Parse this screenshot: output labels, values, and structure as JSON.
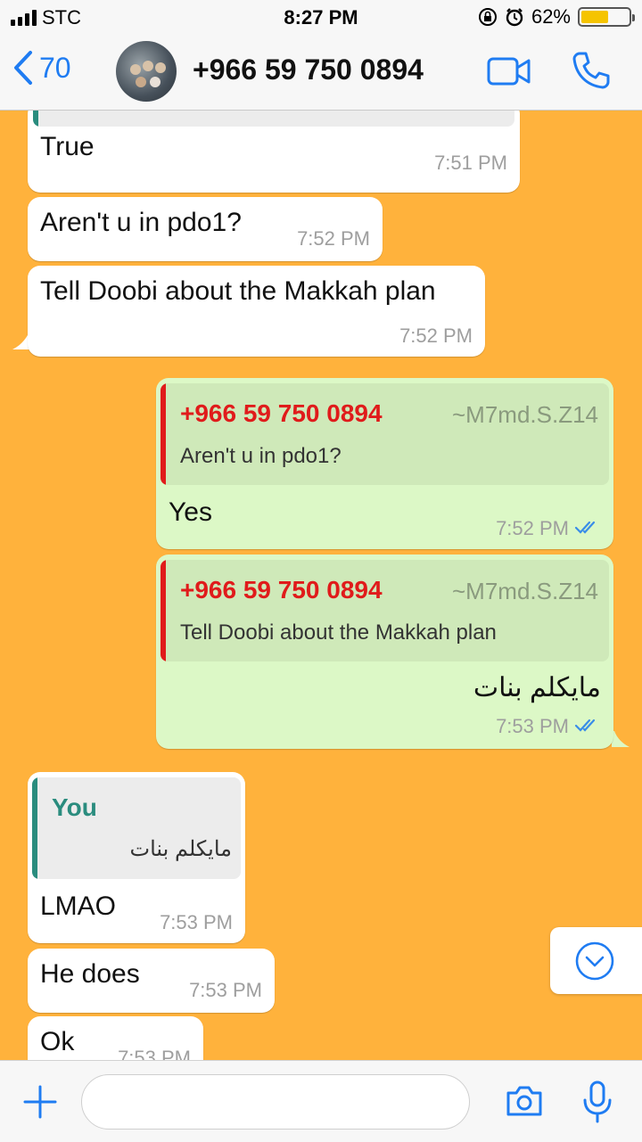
{
  "status_bar": {
    "carrier": "STC",
    "time": "8:27 PM",
    "battery": "62%"
  },
  "header": {
    "back_count": "70",
    "contact": "+966 59 750 0894"
  },
  "messages": {
    "m1": {
      "text": "True",
      "time": "7:51 PM"
    },
    "m2": {
      "text": "Aren't u in pdo1?",
      "time": "7:52 PM"
    },
    "m3": {
      "text": "Tell Doobi about the Makkah plan",
      "time": "7:52 PM"
    },
    "m4": {
      "quote_name": "+966 59 750 0894",
      "quote_sender": "~M7md.S.Z14",
      "quote_text": "Aren't u in pdo1?",
      "text": "Yes",
      "time": "7:52 PM"
    },
    "m5": {
      "quote_name": "+966 59 750 0894",
      "quote_sender": "~M7md.S.Z14",
      "quote_text": "Tell Doobi about the Makkah plan",
      "text": "مايكلم بنات",
      "time": "7:53 PM"
    },
    "m6": {
      "quote_name": "You",
      "quote_text": "مايكلم بنات",
      "text": "LMAO",
      "time": "7:53 PM"
    },
    "m7": {
      "text": "He does",
      "time": "7:53 PM"
    },
    "m8": {
      "text": "Ok",
      "time": "7:53 PM"
    }
  },
  "colors": {
    "background": "#ffb23c",
    "accent": "#1f7cf2",
    "incoming": "#ffffff",
    "outgoing": "#dcf8c6",
    "quote_red": "#e01b1b",
    "quote_teal": "#2a8c7e"
  },
  "icons": [
    "back-chevron-icon",
    "video-call-icon",
    "phone-icon",
    "scroll-down-icon",
    "plus-icon",
    "camera-icon",
    "microphone-icon"
  ]
}
